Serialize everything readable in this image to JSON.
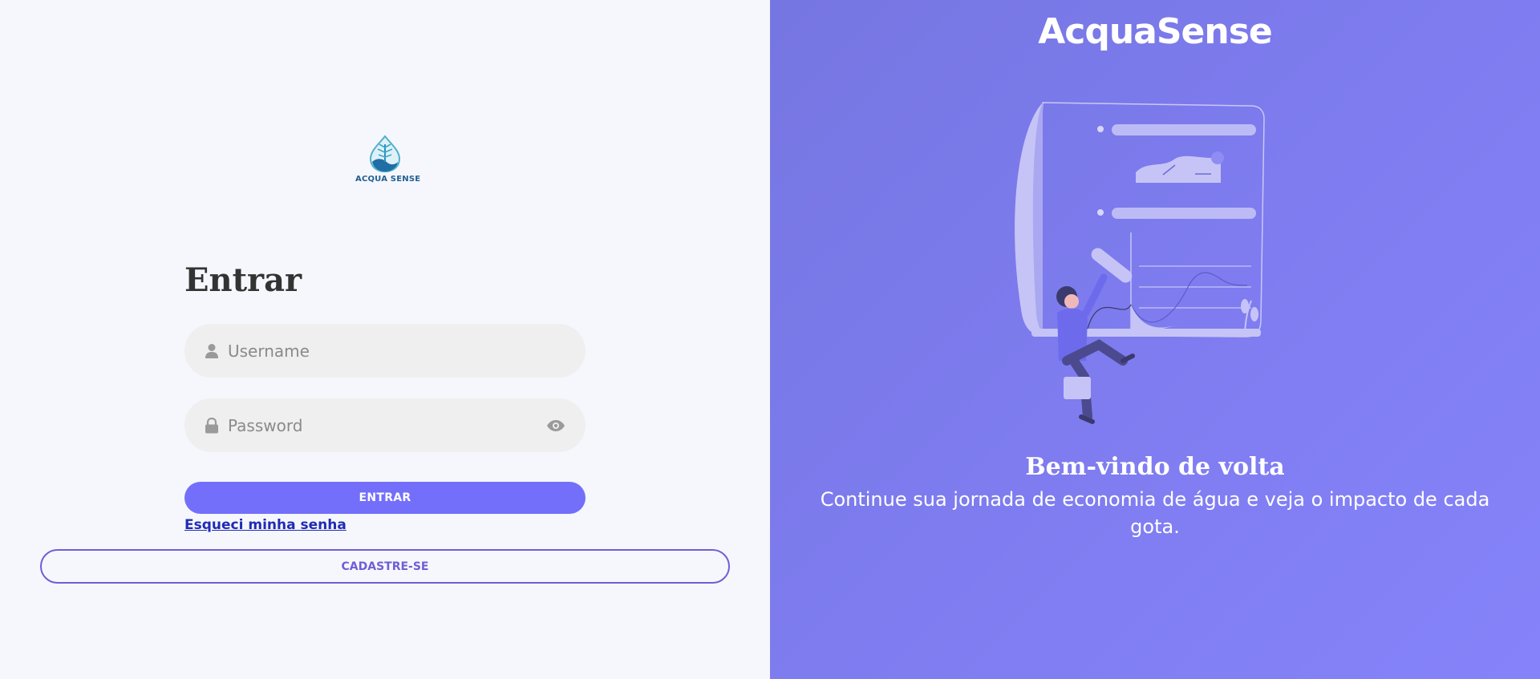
{
  "logo": {
    "text": "ACQUA SENSE"
  },
  "login": {
    "title": "Entrar",
    "username_placeholder": "Username",
    "password_placeholder": "Password",
    "submit_label": "ENTRAR",
    "forgot_label": "Esqueci minha senha",
    "signup_label": "CADASTRE-SE"
  },
  "hero": {
    "brand": "AcquaSense",
    "welcome": "Bem-vindo de volta",
    "subtitle": "Continue sua jornada de economia de água e veja o impacto de cada gota."
  },
  "icons": {
    "username": "user-icon",
    "password": "lock-icon",
    "toggle": "eye-icon"
  },
  "colors": {
    "accent": "#736ffb",
    "panel": "#7e7cef",
    "link": "#1f2bb4"
  }
}
